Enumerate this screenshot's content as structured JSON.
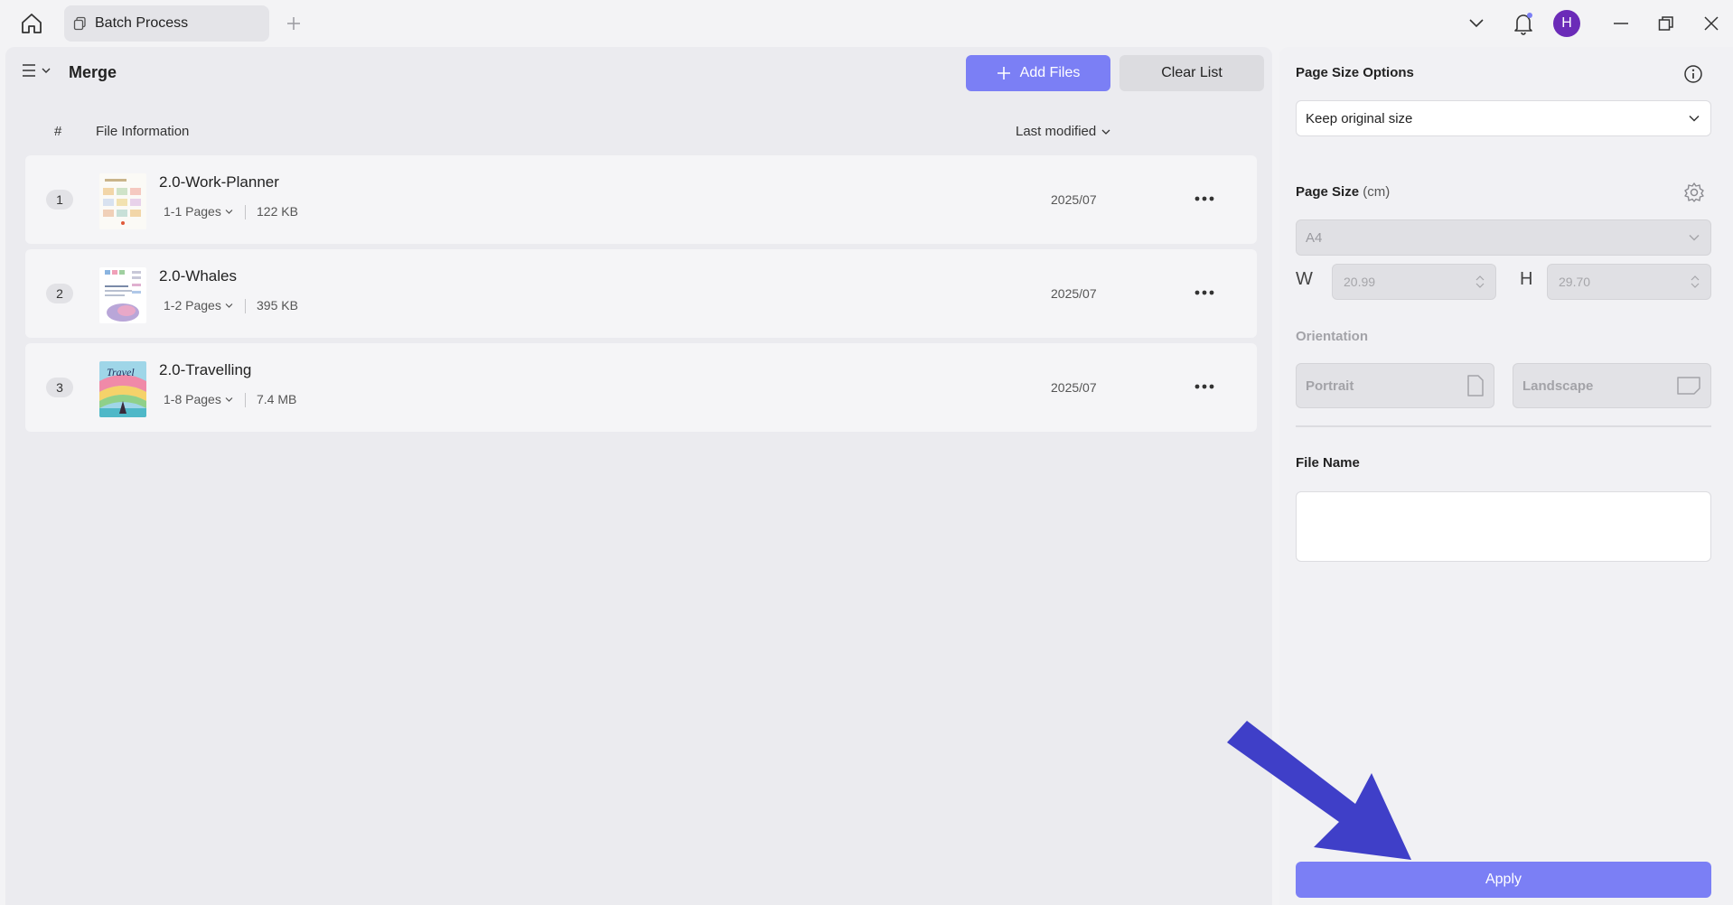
{
  "titlebar": {
    "tab_label": "Batch Process",
    "avatar_initial": "H"
  },
  "toolbar": {
    "title": "Merge",
    "add_files_label": "Add Files",
    "clear_list_label": "Clear List"
  },
  "table": {
    "col_index": "#",
    "col_info": "File Information",
    "col_modified": "Last modified",
    "rows": [
      {
        "index": "1",
        "name": "2.0-Work-Planner",
        "pages": "1-1 Pages",
        "size": "122 KB",
        "date": "2025/07"
      },
      {
        "index": "2",
        "name": "2.0-Whales",
        "pages": "1-2 Pages",
        "size": "395 KB",
        "date": "2025/07"
      },
      {
        "index": "3",
        "name": "2.0-Travelling",
        "pages": "1-8 Pages",
        "size": "7.4 MB",
        "date": "2025/07"
      }
    ]
  },
  "panel": {
    "page_size_options_label": "Page Size Options",
    "page_size_options_value": "Keep original size",
    "page_size_label": "Page Size",
    "page_size_unit": "(cm)",
    "paper_value": "A4",
    "width_letter": "W",
    "width_value": "20.99",
    "height_letter": "H",
    "height_value": "29.70",
    "orientation_label": "Orientation",
    "portrait_label": "Portrait",
    "landscape_label": "Landscape",
    "file_name_label": "File Name",
    "file_name_value": "",
    "apply_label": "Apply"
  },
  "colors": {
    "accent": "#7b7ff5",
    "avatar": "#6b2bb8",
    "arrow": "#3f3fc8"
  }
}
